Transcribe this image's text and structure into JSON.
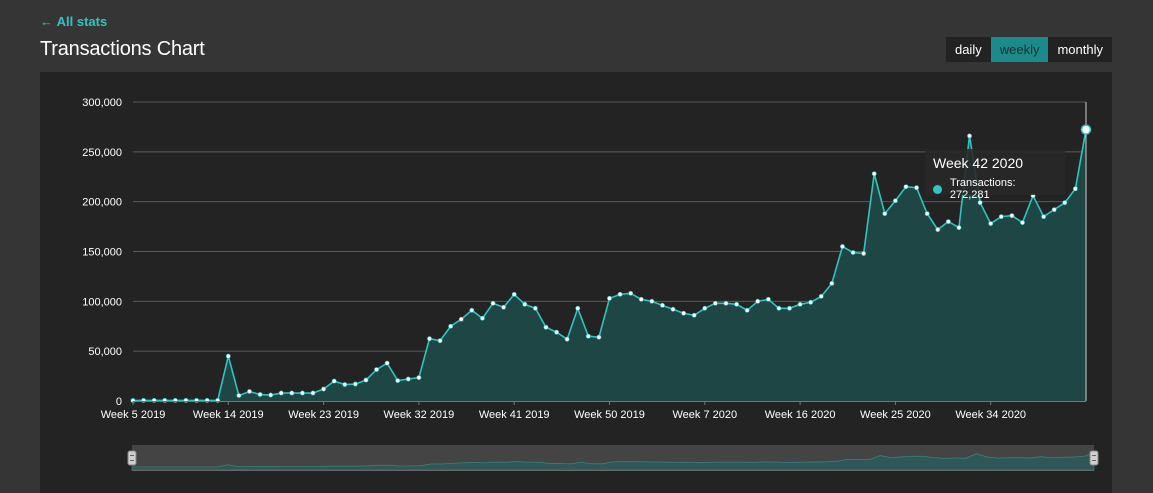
{
  "header": {
    "back_arrow": "←",
    "back_label": "All stats",
    "title": "Transactions Chart"
  },
  "period_toggle": {
    "options": [
      "daily",
      "weekly",
      "monthly"
    ],
    "selected": "weekly"
  },
  "tooltip": {
    "title": "Week 42 2020",
    "series_label": "Transactions: 272,281"
  },
  "colors": {
    "accent": "#2ec4c0",
    "area_fill": "#1e4644",
    "background": "#353535",
    "panel": "#232323"
  },
  "chart_data": {
    "type": "area",
    "title": "",
    "xlabel": "",
    "ylabel": "",
    "ylim": [
      0,
      300000
    ],
    "y_ticks": [
      "0",
      "50,000",
      "100,000",
      "150,000",
      "200,000",
      "250,000",
      "300,000"
    ],
    "x_ticks": [
      "Week 5 2019",
      "Week 14 2019",
      "Week 23 2019",
      "Week 32 2019",
      "Week 41 2019",
      "Week 50 2019",
      "Week 7 2020",
      "Week 16 2020",
      "Week 25 2020",
      "Week 34 2020"
    ],
    "grid": true,
    "series": [
      {
        "name": "Transactions",
        "values": [
          500,
          600,
          600,
          600,
          600,
          600,
          600,
          600,
          600,
          45000,
          5500,
          9500,
          6500,
          6000,
          8000,
          8000,
          8000,
          8000,
          12000,
          20000,
          16500,
          17000,
          21000,
          31500,
          38000,
          20500,
          22000,
          23500,
          62500,
          60500,
          75000,
          82000,
          91000,
          83000,
          98000,
          94000,
          107000,
          97000,
          93000,
          74000,
          69000,
          62000,
          93000,
          65000,
          64000,
          103000,
          107000,
          108000,
          102000,
          100000,
          96000,
          92000,
          88000,
          86000,
          93000,
          98000,
          98000,
          97000,
          91000,
          100000,
          102000,
          93000,
          93000,
          97000,
          99000,
          105000,
          118000,
          155000,
          149000,
          148000,
          228000,
          188000,
          201000,
          215000,
          214000,
          188000,
          172000,
          180000,
          174000,
          266000,
          199000,
          178000,
          185000,
          186000,
          179000,
          206000,
          185000,
          192000,
          199000,
          213000,
          272281
        ],
        "highlight_index": 90
      }
    ]
  },
  "navigator": {
    "label": "range-navigator"
  }
}
